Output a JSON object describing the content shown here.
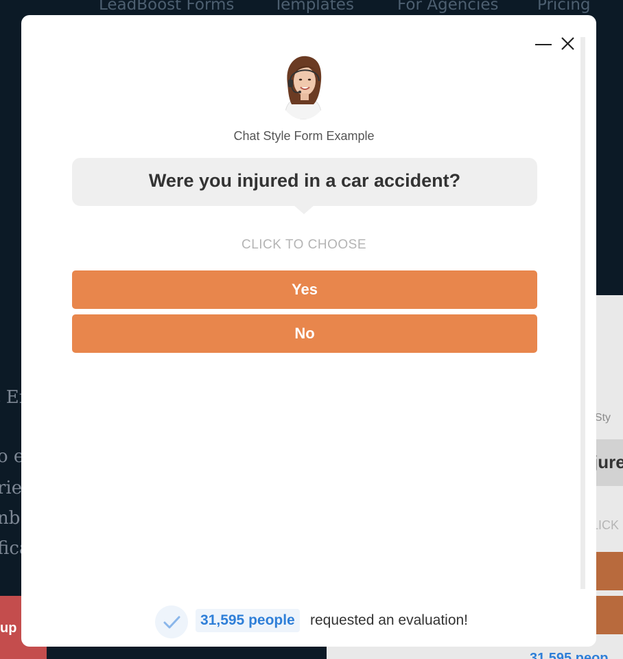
{
  "background": {
    "nav": [
      "LeadBoost Forms",
      "Templates",
      "For Agencies",
      "Pricing"
    ],
    "left_fragments": [
      "t En",
      "o e",
      "rie",
      "nb",
      "fica"
    ],
    "right_panel": {
      "label": "t Sty",
      "question": "jure",
      "click": "LICK",
      "count": "31,595 peop"
    },
    "red_button_label": "up"
  },
  "modal": {
    "minimize_icon": "minimize-icon",
    "close_icon": "close-icon",
    "title": "Chat Style Form Example",
    "question": "Were you injured in a car accident?",
    "choose_label": "CLICK TO CHOOSE",
    "options": [
      "Yes",
      "No"
    ],
    "social_proof": {
      "count": "31,595 people",
      "text": "requested an evaluation!"
    }
  },
  "colors": {
    "background": "#0c1a26",
    "button": "#e8864c",
    "accent_blue": "#2f7fd8",
    "bubble": "#efefef"
  }
}
